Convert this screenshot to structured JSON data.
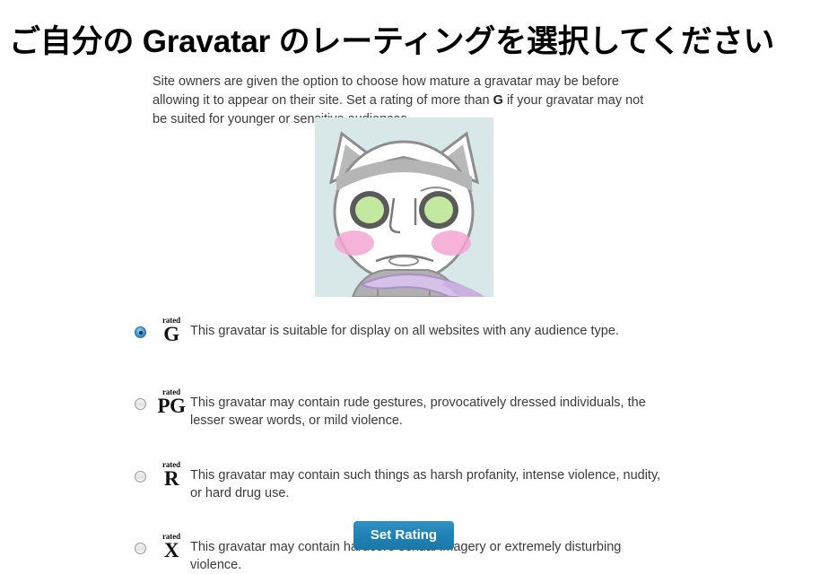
{
  "page": {
    "title": "ご自分の Gravatar のレーティングを選択してください",
    "intro_part1": "Site owners are given the option to choose how mature a gravatar may be before allowing it to appear on their site. Set a rating of more than ",
    "intro_bold": "G",
    "intro_part2": " if your gravatar may not be suited for younger or sensitive audiences."
  },
  "avatar": {
    "alt": "gravatar-preview-cat-character",
    "background_color": "#d8e8e8",
    "eye_color": "#c3e8a0",
    "cheek_color": "#f4a6d4",
    "scarf_color": "#d6c2e8",
    "fur_color": "#b5b5b5"
  },
  "ratings": {
    "rated_word": "rated",
    "options": [
      {
        "value": "G",
        "letter": "G",
        "selected": true,
        "description": "This gravatar is suitable for display on all websites with any audience type."
      },
      {
        "value": "PG",
        "letter": "PG",
        "selected": false,
        "description": "This gravatar may contain rude gestures, provocatively dressed individuals, the lesser swear words, or mild violence."
      },
      {
        "value": "R",
        "letter": "R",
        "selected": false,
        "description": "This gravatar may contain such things as harsh profanity, intense violence, nudity, or hard drug use."
      },
      {
        "value": "X",
        "letter": "X",
        "selected": false,
        "description": "This gravatar may contain hardcore sexual imagery or extremely disturbing violence."
      }
    ]
  },
  "submit": {
    "label": "Set Rating",
    "color": "#1f81b4"
  }
}
